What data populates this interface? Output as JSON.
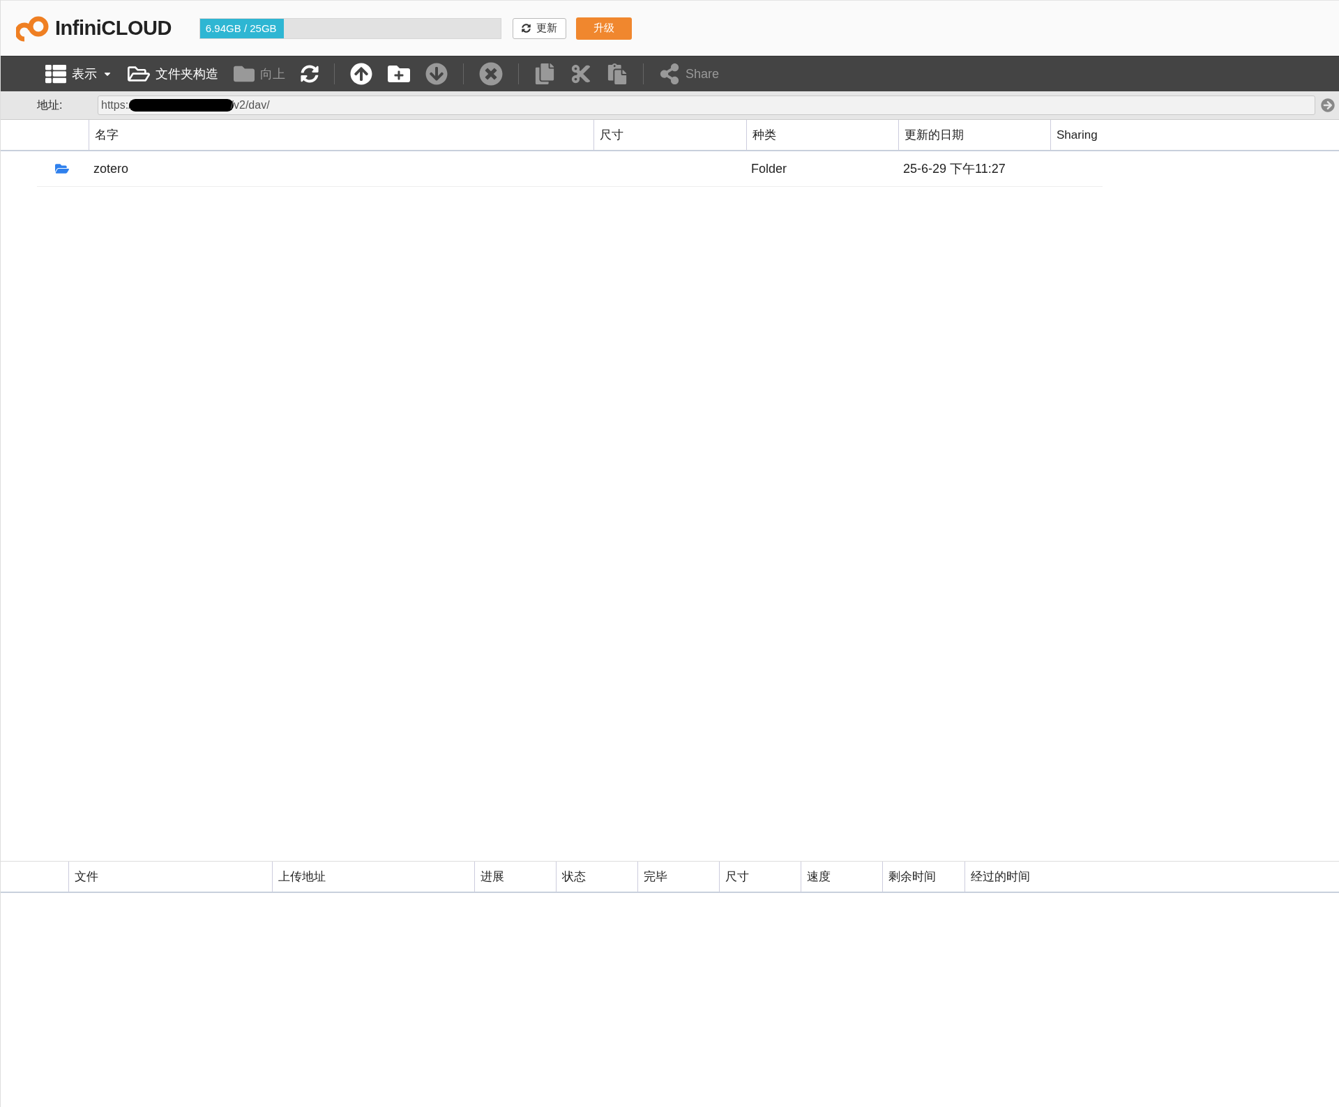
{
  "header": {
    "logo": "InfiniCLOUD",
    "storage": {
      "text": "6.94GB / 25GB",
      "level": 0.278
    },
    "refresh_button": "更新",
    "upgrade_button": "升级"
  },
  "toolbar": [
    {
      "kind": "view",
      "label": "表示",
      "disabled": false
    },
    {
      "kind": "folders",
      "label": "文件夹构造",
      "disabled": false
    },
    {
      "kind": "up",
      "label": "向上",
      "disabled": true
    },
    {
      "kind": "refresh",
      "disabled": false
    },
    {
      "kind": "separator"
    },
    {
      "kind": "upload",
      "disabled": false
    },
    {
      "kind": "new-folder",
      "disabled": false
    },
    {
      "kind": "download",
      "disabled": true
    },
    {
      "kind": "separator"
    },
    {
      "kind": "delete",
      "disabled": true
    },
    {
      "kind": "separator"
    },
    {
      "kind": "copy",
      "disabled": true
    },
    {
      "kind": "cut",
      "disabled": true
    },
    {
      "kind": "paste",
      "disabled": true
    },
    {
      "kind": "separator"
    },
    {
      "kind": "share",
      "label": "Share",
      "disabled": true
    }
  ],
  "address": {
    "label": "地址:",
    "value_start": "https:/",
    "value_end": "/v2/dav/"
  },
  "files": {
    "columns": [
      "名字",
      "尺寸",
      "种类",
      "更新的日期",
      "Sharing"
    ],
    "rows": [
      {
        "name": "zotero",
        "size": "",
        "type": "Folder",
        "date": "25-6-29 下午11:27",
        "sharing": ""
      }
    ]
  },
  "uploads": {
    "columns": [
      "文件",
      "上传地址",
      "进展",
      "状态",
      "完毕",
      "尺寸",
      "速度",
      "剩余时间",
      "经过的时间"
    ]
  }
}
